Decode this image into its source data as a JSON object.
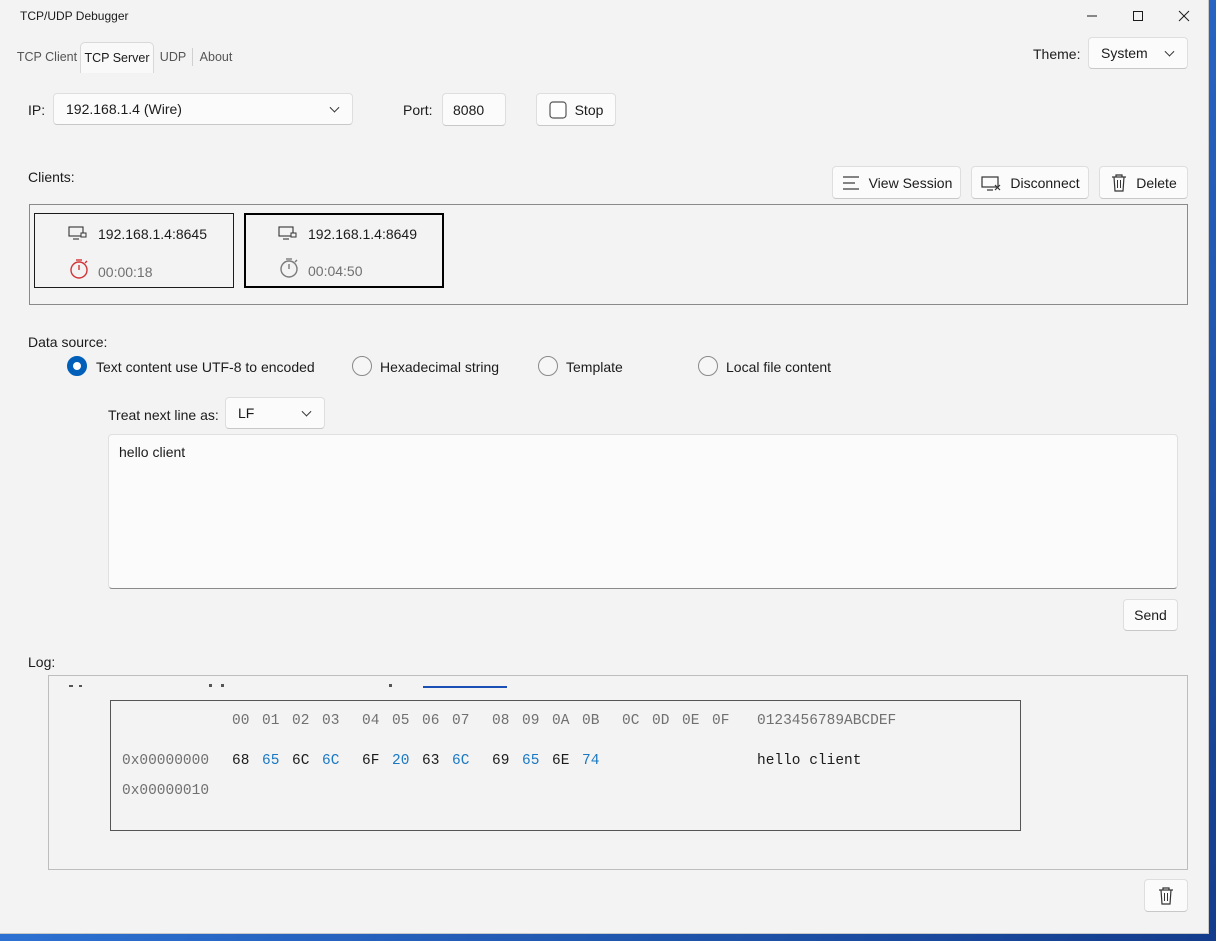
{
  "window": {
    "title": "TCP/UDP Debugger"
  },
  "tabs": [
    {
      "label": "TCP Client"
    },
    {
      "label": "TCP Server"
    },
    {
      "label": "UDP"
    },
    {
      "label": "About"
    }
  ],
  "theme": {
    "label": "Theme:",
    "value": "System"
  },
  "server": {
    "ip_label": "IP:",
    "ip_value": "192.168.1.4 (Wire)",
    "port_label": "Port:",
    "port_value": "8080",
    "stop_label": "Stop"
  },
  "clients": {
    "label": "Clients:",
    "view_session_label": "View Session",
    "disconnect_label": "Disconnect",
    "delete_label": "Delete",
    "items": [
      {
        "address": "192.168.1.4:8645",
        "time": "00:00:18",
        "timer_color": "#d13438"
      },
      {
        "address": "192.168.1.4:8649",
        "time": "00:04:50",
        "timer_color": "#7a7a7a"
      }
    ]
  },
  "data_source": {
    "label": "Data source:",
    "options": [
      {
        "label": "Text content use UTF-8 to encoded",
        "selected": true
      },
      {
        "label": "Hexadecimal string",
        "selected": false
      },
      {
        "label": "Template",
        "selected": false
      },
      {
        "label": "Local file content",
        "selected": false
      }
    ],
    "newline_label": "Treat next line as:",
    "newline_value": "LF",
    "content": "hello client",
    "send_label": "Send"
  },
  "log": {
    "label": "Log:",
    "hex_header": [
      "00",
      "01",
      "02",
      "03",
      "04",
      "05",
      "06",
      "07",
      "08",
      "09",
      "0A",
      "0B",
      "0C",
      "0D",
      "0E",
      "0F"
    ],
    "ascii_header": "0123456789ABCDEF",
    "rows": [
      {
        "offset": "0x00000000",
        "bytes": [
          "68",
          "65",
          "6C",
          "6C",
          "6F",
          "20",
          "63",
          "6C",
          "69",
          "65",
          "6E",
          "74"
        ],
        "ascii": "hello client"
      },
      {
        "offset": "0x00000010",
        "bytes": [],
        "ascii": ""
      }
    ]
  },
  "colors": {
    "accent": "#005fb8",
    "hex_odd": "#1a78c2"
  }
}
